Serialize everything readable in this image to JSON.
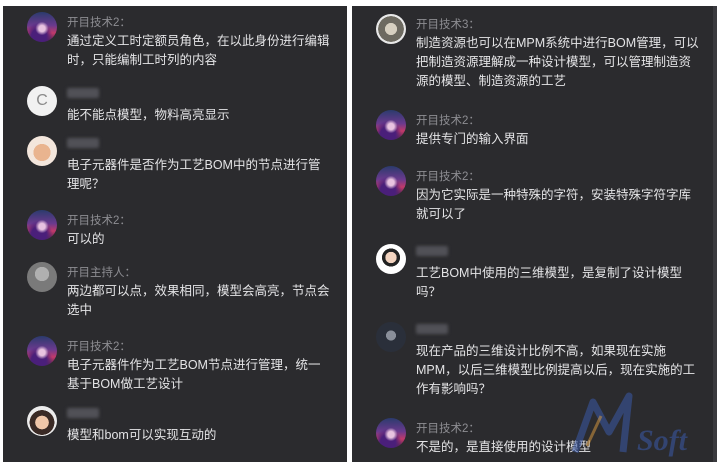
{
  "left_panel": {
    "messages": [
      {
        "sender": "开目技术2：",
        "text": "通过定义工时定额员角色，在以此身份进行编辑时，只能编制工时列的内容",
        "avatar": "host-avatar"
      },
      {
        "sender": "",
        "text": "能不能点模型，物料高亮显示",
        "avatar": "letter-c-avatar",
        "avatar_letter": "C"
      },
      {
        "sender": "",
        "text": "电子元器件是否作为工艺BOM中的节点进行管理呢？",
        "avatar": "baby-avatar"
      },
      {
        "sender": "开目技术2：",
        "text": "可以的",
        "avatar": "host-avatar"
      },
      {
        "sender": "开目主持人：",
        "text": "两边都可以点，效果相同，模型会高亮，节点会选中",
        "avatar": "presenter-avatar"
      },
      {
        "sender": "开目技术2：",
        "text": "电子元器件作为工艺BOM节点进行管理，统一基于BOM做工艺设计",
        "avatar": "host-avatar"
      },
      {
        "sender": "",
        "text": "模型和bom可以实现互动的",
        "avatar": "girl-avatar"
      }
    ]
  },
  "right_panel": {
    "messages": [
      {
        "sender": "开目技术3：",
        "text": "制造资源也可以在MPM系统中进行BOM管理，可以把制造资源理解成一种设计模型，可以管理制造资源的模型、制造资源的工艺",
        "avatar": "square-avatar"
      },
      {
        "sender": "开目技术2：",
        "text": "提供专门的输入界面",
        "avatar": "host-avatar"
      },
      {
        "sender": "开目技术2：",
        "text": "因为它实际是一种特殊的字符，安装特殊字符字库就可以了",
        "avatar": "host-avatar"
      },
      {
        "sender": "",
        "text": "工艺BOM中使用的三维模型，是复制了设计模型吗？",
        "avatar": "man-avatar"
      },
      {
        "sender": "",
        "text": "现在产品的三维设计比例不高，如果现在实施MPM，以后三维模型比例提高以后，现在实施的工作有影响吗？",
        "avatar": "dark-avatar"
      },
      {
        "sender": "开目技术2：",
        "text": "不是的，是直接使用的设计模型",
        "avatar": "host-avatar"
      }
    ]
  },
  "watermark": {
    "text": "Soft",
    "color": "#3a5aa8"
  }
}
